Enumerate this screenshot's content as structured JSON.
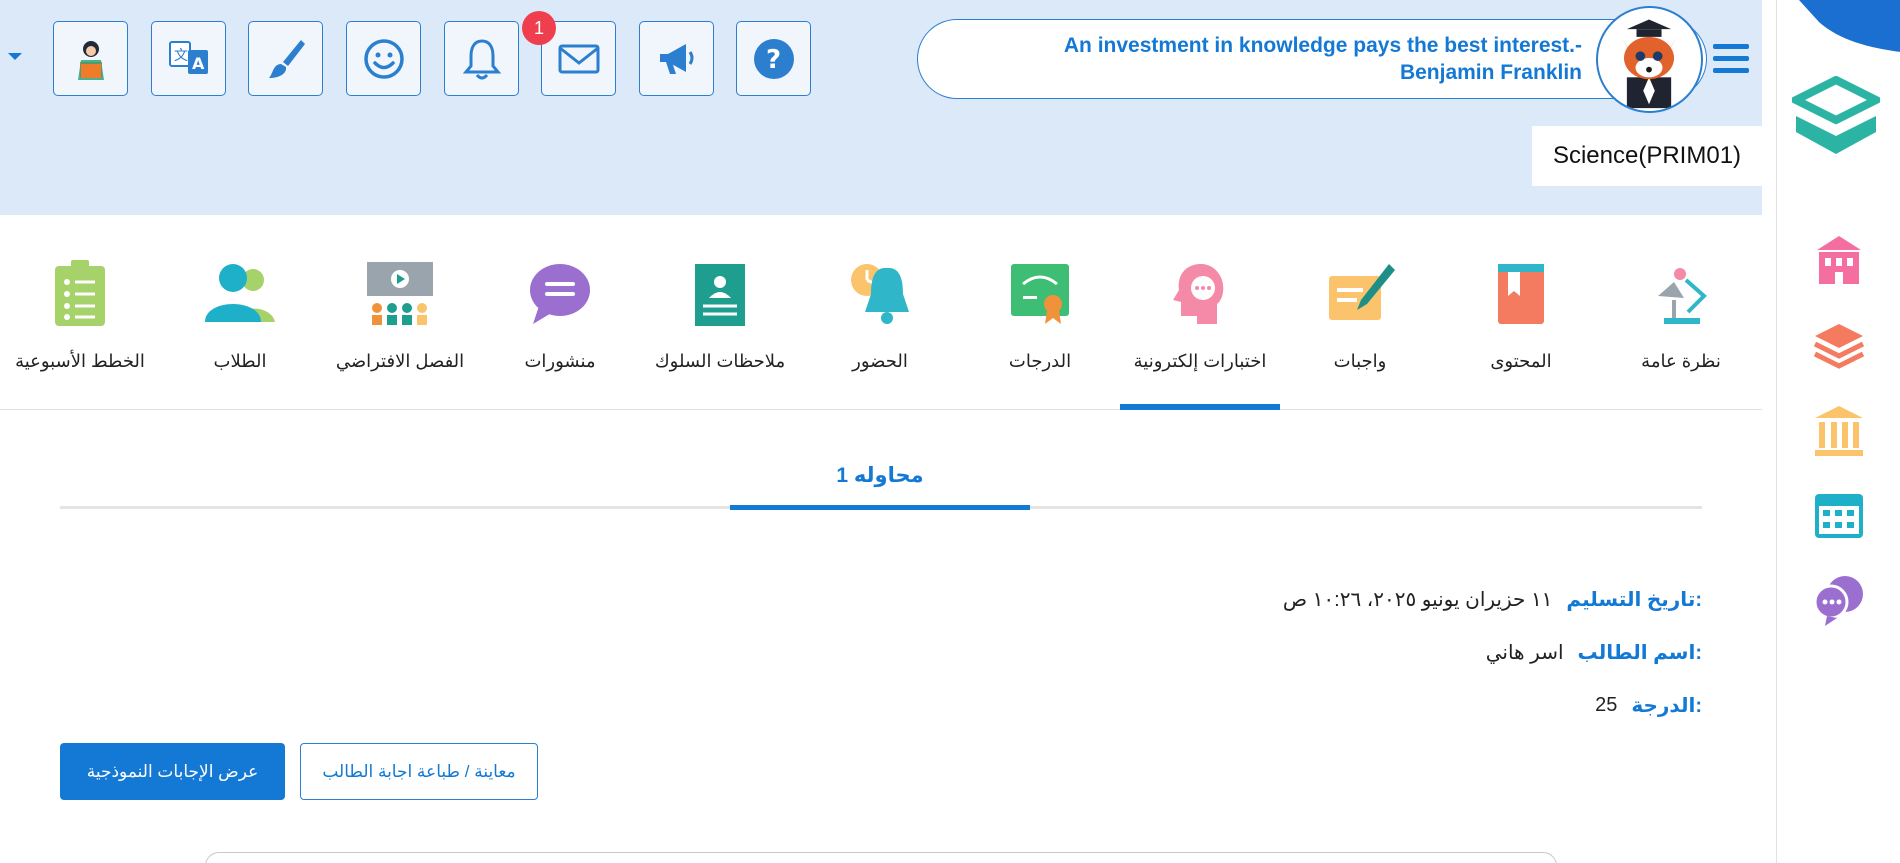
{
  "header": {
    "quote": "An investment in knowledge pays the best interest.- Benjamin Franklin",
    "course_name": "Science(PRIM01)",
    "notification_count": "1",
    "toolbar": [
      {
        "name": "teacher-profile-button",
        "icon": "teacher-icon"
      },
      {
        "name": "language-button",
        "icon": "translate-icon"
      },
      {
        "name": "theme-button",
        "icon": "brush-icon"
      },
      {
        "name": "mood-button",
        "icon": "smiley-icon"
      },
      {
        "name": "notifications-button",
        "icon": "bell-icon"
      },
      {
        "name": "messages-button",
        "icon": "mail-icon"
      },
      {
        "name": "announcements-button",
        "icon": "megaphone-icon"
      },
      {
        "name": "help-button",
        "icon": "help-icon"
      }
    ]
  },
  "nav": {
    "items": [
      {
        "label": "نظرة عامة",
        "icon": "overview-icon"
      },
      {
        "label": "المحتوى",
        "icon": "book-icon"
      },
      {
        "label": "واجبات",
        "icon": "assignment-icon"
      },
      {
        "label": "اختبارات إلكترونية",
        "icon": "quiz-icon",
        "active": true
      },
      {
        "label": "الدرجات",
        "icon": "certificate-icon"
      },
      {
        "label": "الحضور",
        "icon": "attendance-bell-icon"
      },
      {
        "label": "ملاحظات السلوك",
        "icon": "behavior-note-icon"
      },
      {
        "label": "منشورات",
        "icon": "chat-bubble-icon"
      },
      {
        "label": "الفصل الافتراضي",
        "icon": "virtual-class-icon"
      },
      {
        "label": "الطلاب",
        "icon": "students-icon"
      },
      {
        "label": "الخطط الأسبوعية",
        "icon": "weekly-plan-icon"
      }
    ]
  },
  "attempt": {
    "tab_label": "محاوله 1",
    "submission_label": "تاريخ التسليم:",
    "submission_value": "١١ حزيران يونيو ٢٠٢٥، ١٠:٢٦ ص",
    "student_label": "اسم الطالب:",
    "student_value": "اسر هاني",
    "grade_label": "الدرجة:",
    "grade_value": "25",
    "model_answers_button": "عرض الإجابات النموذجية",
    "preview_print_button": "معاينة / طباعة اجابة الطالب"
  },
  "sidebar": {
    "icons": [
      "school-icon",
      "layers-icon",
      "institution-icon",
      "calendar-icon",
      "chat-support-icon"
    ]
  },
  "colors": {
    "accent": "#1479d4",
    "header_bg": "#dbe9f8",
    "badge": "#ef3f4e"
  }
}
